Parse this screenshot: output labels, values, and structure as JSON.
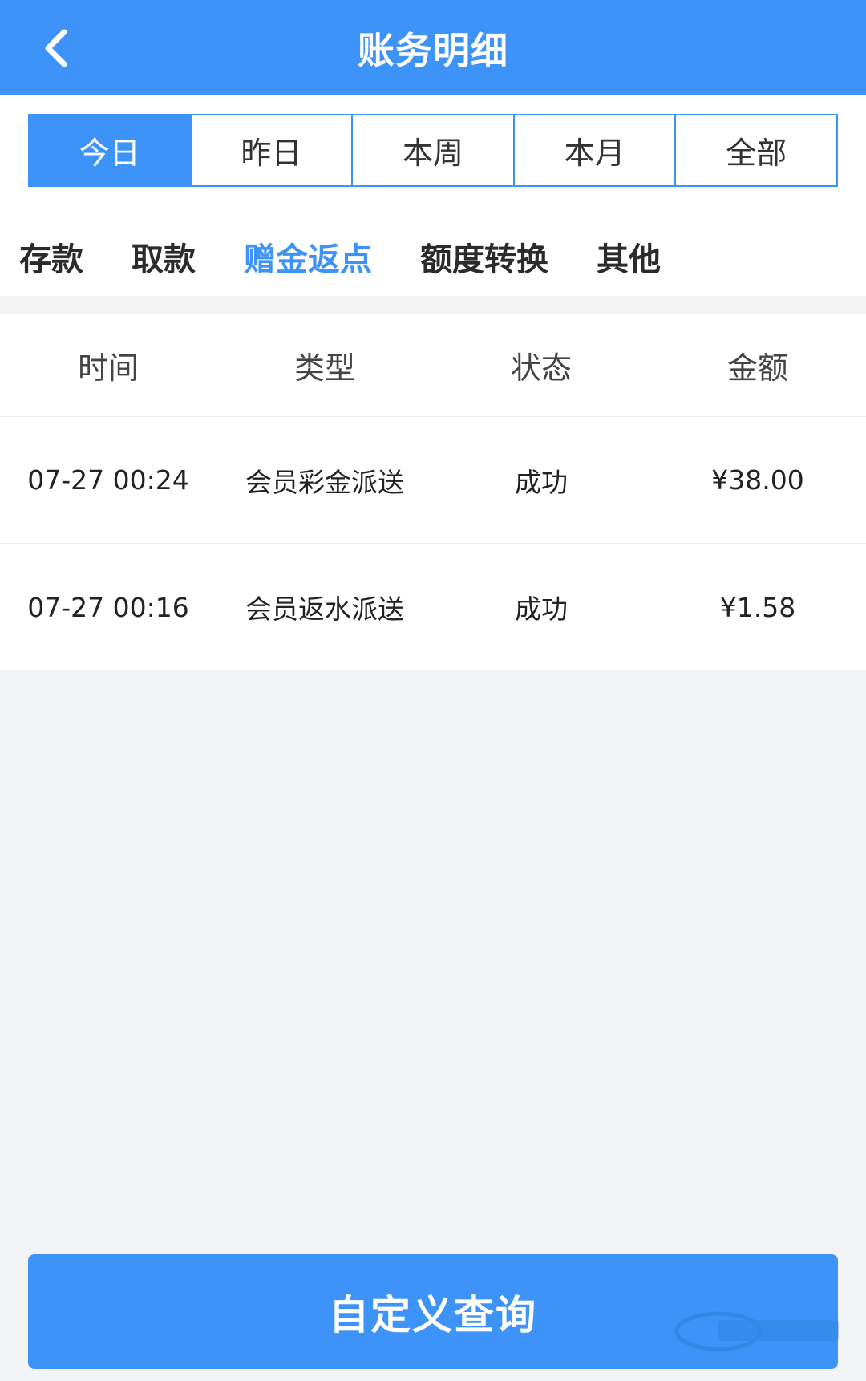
{
  "header": {
    "title": "账务明细",
    "back_icon": "chevron-left-icon"
  },
  "date_tabs": [
    {
      "label": "今日",
      "active": true
    },
    {
      "label": "昨日",
      "active": false
    },
    {
      "label": "本周",
      "active": false
    },
    {
      "label": "本月",
      "active": false
    },
    {
      "label": "全部",
      "active": false
    }
  ],
  "category_tabs": [
    {
      "label": "存款",
      "active": false
    },
    {
      "label": "取款",
      "active": false
    },
    {
      "label": "赠金返点",
      "active": true
    },
    {
      "label": "额度转换",
      "active": false
    },
    {
      "label": "其他",
      "active": false
    }
  ],
  "table": {
    "columns": [
      "时间",
      "类型",
      "状态",
      "金额"
    ],
    "rows": [
      {
        "time": "07-27 00:24",
        "type": "会员彩金派送",
        "status": "成功",
        "amount": "¥38.00"
      },
      {
        "time": "07-27 00:16",
        "type": "会员返水派送",
        "status": "成功",
        "amount": "¥1.58"
      }
    ]
  },
  "footer": {
    "query_button": "自定义查询"
  },
  "colors": {
    "primary": "#3d93f8",
    "success": "#59b52c",
    "background": "#f3f4f6"
  }
}
